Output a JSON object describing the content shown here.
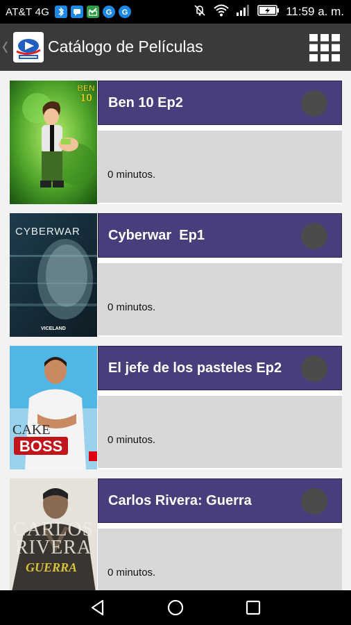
{
  "status_bar": {
    "carrier": "AT&T 4G",
    "time": "11:59 a. m.",
    "notification_icons": [
      "bluetooth-icon",
      "chat-icon",
      "hangouts-icon",
      "google-icon",
      "google-icon"
    ],
    "system_icons": [
      "mute-icon",
      "wifi-icon",
      "signal-icon",
      "battery-charging-icon"
    ]
  },
  "app_bar": {
    "title": "Catálogo de Películas",
    "logo_icon": "app-logo-icon",
    "menu_icon": "grid-menu-icon"
  },
  "movies": [
    {
      "title": "Ben 10 Ep2",
      "duration": "0 minutos.",
      "poster": "ben10-poster",
      "poster_text": "BEN 10"
    },
    {
      "title": "Cyberwar  Ep1",
      "duration": "0 minutos.",
      "poster": "cyberwar-poster",
      "poster_text": "CYBERWAR",
      "poster_subtext": "VICELAND"
    },
    {
      "title": "El jefe de los pasteles Ep2",
      "duration": "0 minutos.",
      "poster": "cake-boss-poster",
      "poster_text": "CAKE",
      "poster_subtext": "BOSS"
    },
    {
      "title": "Carlos Rivera: Guerra",
      "duration": "0 minutos.",
      "poster": "carlos-rivera-poster",
      "poster_text": "CARLOS RIVERA",
      "poster_subtext": "GUERRA"
    }
  ],
  "nav_bar": {
    "icons": [
      "back-icon",
      "home-icon",
      "recents-icon"
    ]
  },
  "colors": {
    "status_bar": "#000000",
    "app_bar": "#3a3a3a",
    "title_box": "#4a3d7c",
    "info_box": "#d8d8d8",
    "background": "#f2f2f2"
  }
}
